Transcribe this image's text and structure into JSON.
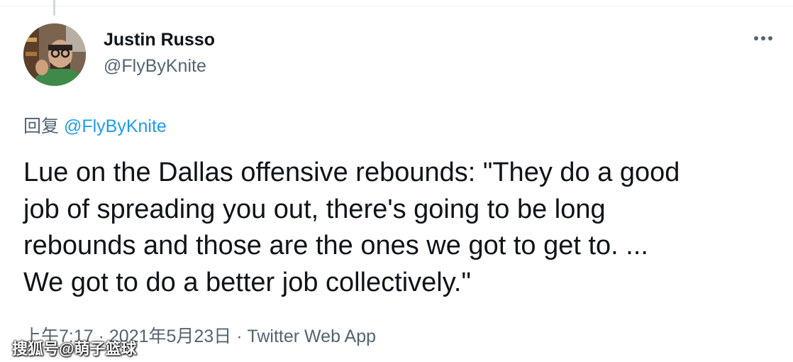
{
  "author": {
    "name": "Justin Russo",
    "handle": "@FlyByKnite"
  },
  "reply": {
    "prefix": "回复",
    "mention": "@FlyByKnite"
  },
  "tweet": {
    "lines": [
      "Lue on the Dallas offensive rebounds: \"They do a good",
      "job of spreading you out, there's going to be long",
      "rebounds and those are the ones we got to get to. ...",
      "We got to do a better job collectively.\""
    ]
  },
  "meta": {
    "time": "上午7:17",
    "separator": "·",
    "date": "2021年5月23日",
    "source": "Twitter Web App"
  },
  "watermark": {
    "text": "搜狐号@萌子篮球"
  },
  "icons": {
    "more": "more-horizontal-icon"
  },
  "colors": {
    "text": "#0f1419",
    "secondary": "#536471",
    "link": "#1d9bf0"
  }
}
